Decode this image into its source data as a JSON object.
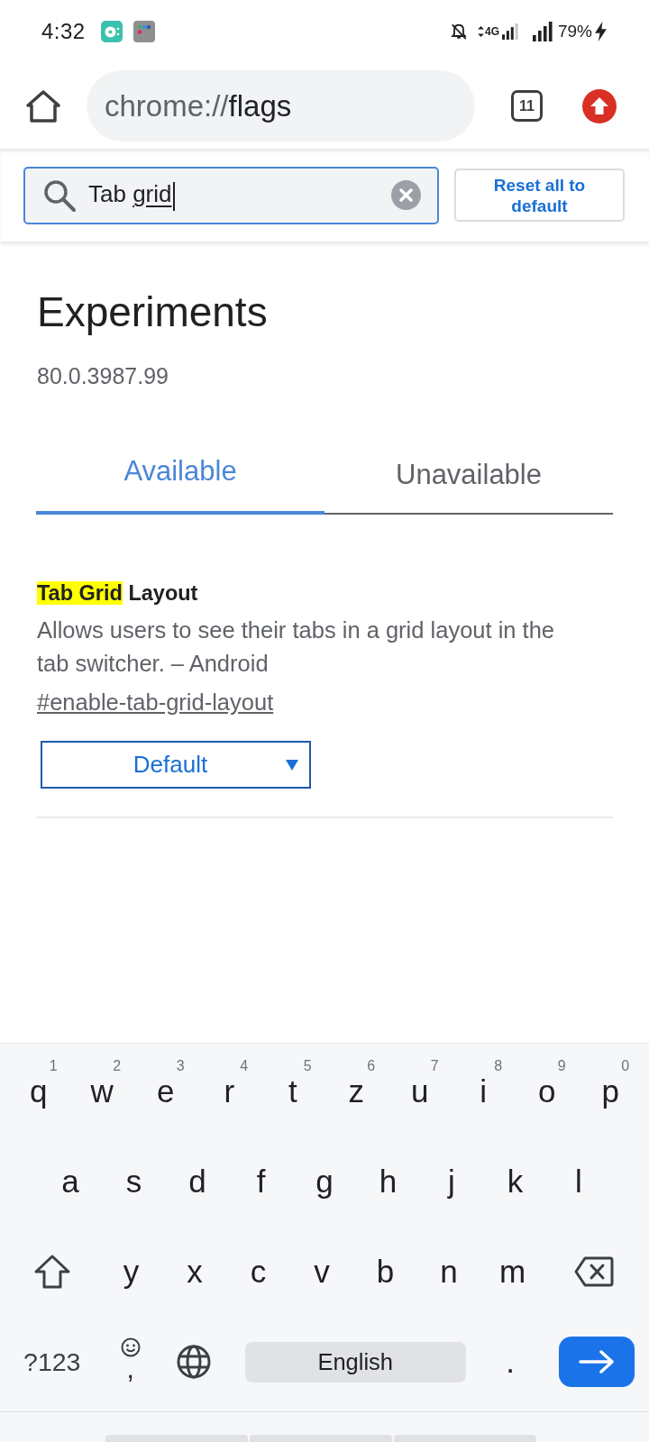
{
  "status_bar": {
    "time": "4:32",
    "network": "4G",
    "battery": "79%",
    "charging": true
  },
  "toolbar": {
    "url_scheme": "chrome://",
    "url_path": "flags",
    "tab_count": "11"
  },
  "search": {
    "parts": [
      {
        "text": "Tab",
        "composing": false
      },
      {
        "text": "grid",
        "composing": true
      }
    ]
  },
  "reset_button": {
    "label": "Reset all to default"
  },
  "page": {
    "title": "Experiments",
    "version": "80.0.3987.99"
  },
  "tabs": [
    {
      "label": "Available",
      "selected": true
    },
    {
      "label": "Unavailable",
      "selected": false
    }
  ],
  "flags": [
    {
      "title": [
        {
          "text": "Tab Grid",
          "highlighted": true
        },
        {
          "text": "Layout",
          "highlighted": false
        }
      ],
      "description": "Allows users to see their tabs in a grid layout in the tab switcher. – Android",
      "anchor": "#enable-tab-grid-layout",
      "select": {
        "value": "Default"
      }
    }
  ],
  "keyboard": {
    "rows": [
      {
        "keys": [
          {
            "kind": "letter",
            "label": "q",
            "hint": "1"
          },
          {
            "kind": "letter",
            "label": "w",
            "hint": "2"
          },
          {
            "kind": "letter",
            "label": "e",
            "hint": "3"
          },
          {
            "kind": "letter",
            "label": "r",
            "hint": "4"
          },
          {
            "kind": "letter",
            "label": "t",
            "hint": "5"
          },
          {
            "kind": "letter",
            "label": "z",
            "hint": "6"
          },
          {
            "kind": "letter",
            "label": "u",
            "hint": "7"
          },
          {
            "kind": "letter",
            "label": "i",
            "hint": "8"
          },
          {
            "kind": "letter",
            "label": "o",
            "hint": "9"
          },
          {
            "kind": "letter",
            "label": "p",
            "hint": "0"
          }
        ]
      },
      {
        "keys": [
          {
            "kind": "letter",
            "label": "a"
          },
          {
            "kind": "letter",
            "label": "s"
          },
          {
            "kind": "letter",
            "label": "d"
          },
          {
            "kind": "letter",
            "label": "f"
          },
          {
            "kind": "letter",
            "label": "g"
          },
          {
            "kind": "letter",
            "label": "h"
          },
          {
            "kind": "letter",
            "label": "j"
          },
          {
            "kind": "letter",
            "label": "k"
          },
          {
            "kind": "letter",
            "label": "l"
          }
        ]
      },
      {
        "keys": [
          {
            "kind": "shift"
          },
          {
            "kind": "letter",
            "label": "y"
          },
          {
            "kind": "letter",
            "label": "x"
          },
          {
            "kind": "letter",
            "label": "c"
          },
          {
            "kind": "letter",
            "label": "v"
          },
          {
            "kind": "letter",
            "label": "b"
          },
          {
            "kind": "letter",
            "label": "n"
          },
          {
            "kind": "letter",
            "label": "m"
          },
          {
            "kind": "backspace"
          }
        ]
      },
      {
        "keys": [
          {
            "kind": "symbols",
            "label": "?123"
          },
          {
            "kind": "emoji_comma",
            "label": ","
          },
          {
            "kind": "language"
          },
          {
            "kind": "space",
            "label": "English"
          },
          {
            "kind": "letter",
            "label": "."
          },
          {
            "kind": "enter"
          }
        ]
      }
    ]
  }
}
